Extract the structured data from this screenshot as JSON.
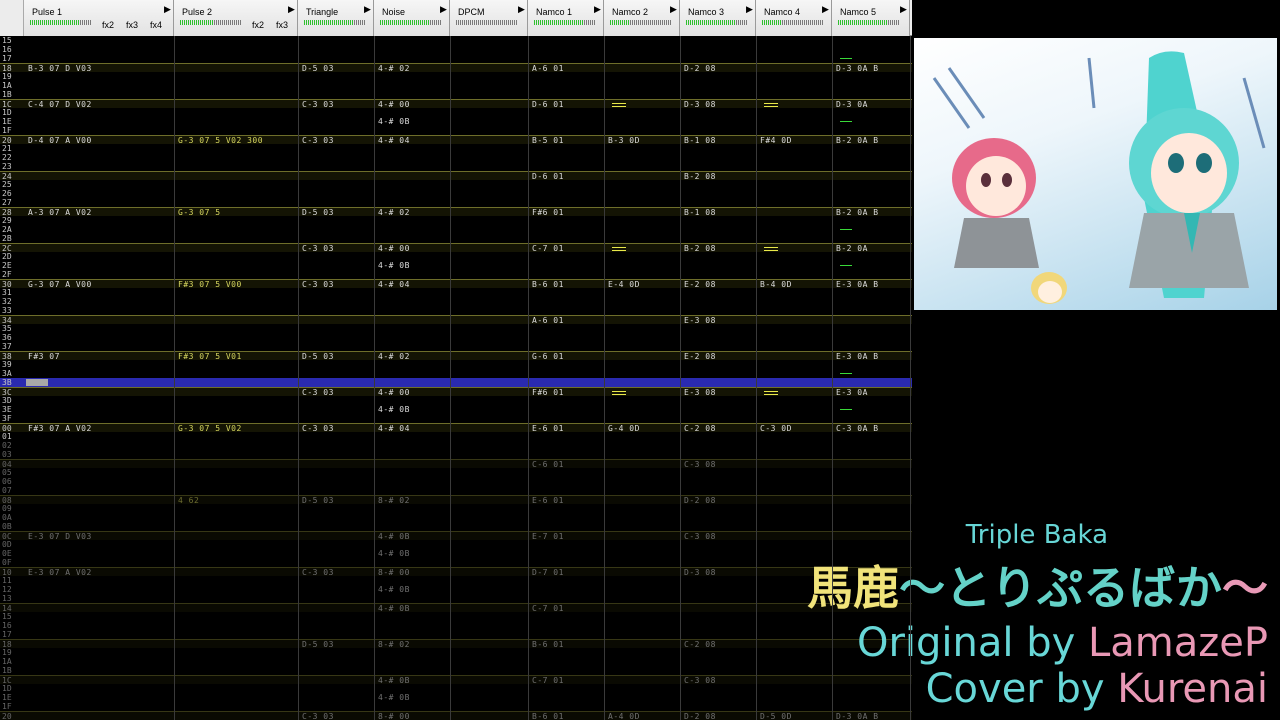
{
  "channels": [
    {
      "name": "Pulse 1",
      "fx": [
        "fx2",
        "fx3",
        "fx4"
      ],
      "meter": 0.8
    },
    {
      "name": "Pulse 2",
      "fx": [
        "fx2",
        "fx3"
      ],
      "meter": 0.55
    },
    {
      "name": "Triangle",
      "fx": [],
      "meter": 0.8
    },
    {
      "name": "Noise",
      "fx": [],
      "meter": 0.8
    },
    {
      "name": "DPCM",
      "fx": [],
      "meter": 0
    },
    {
      "name": "Namco 1",
      "fx": [],
      "meter": 0.8
    },
    {
      "name": "Namco 2",
      "fx": [],
      "meter": 0.3
    },
    {
      "name": "Namco 3",
      "fx": [],
      "meter": 0.8
    },
    {
      "name": "Namco 4",
      "fx": [],
      "meter": 0.3
    },
    {
      "name": "Namco 5",
      "fx": [],
      "meter": 0.8
    }
  ],
  "rows": [
    {
      "n": "15"
    },
    {
      "n": "16"
    },
    {
      "n": "17"
    },
    {
      "n": "18",
      "c": [
        "B-3 07 D V03",
        "",
        "D-5 03",
        "4-# 02",
        "",
        "A-6 01",
        "",
        "D-2 08",
        "",
        "D-3 0A B"
      ]
    },
    {
      "n": "19"
    },
    {
      "n": "1A"
    },
    {
      "n": "1B"
    },
    {
      "n": "1C",
      "c": [
        "C-4 07 D V02",
        "",
        "C-3 03",
        "4-# 00",
        "",
        "D-6 01",
        "",
        "D-3 08",
        "",
        "D-3 0A"
      ]
    },
    {
      "n": "1D"
    },
    {
      "n": "1E",
      "c": [
        "",
        "",
        "",
        "4-# 0B",
        "",
        "",
        "",
        "",
        "",
        ""
      ]
    },
    {
      "n": "1F"
    },
    {
      "n": "20",
      "c": [
        "D-4 07 A V00",
        "G-3 07 5 V02 300",
        "C-3 03",
        "4-# 04",
        "",
        "B-5 01",
        "B-3 0D",
        "B-1 08",
        "F#4 0D",
        "B-2 0A B"
      ]
    },
    {
      "n": "21"
    },
    {
      "n": "22"
    },
    {
      "n": "23"
    },
    {
      "n": "24",
      "c": [
        "",
        "",
        "",
        "",
        "",
        "D-6 01",
        "",
        "B-2 08",
        "",
        ""
      ]
    },
    {
      "n": "25"
    },
    {
      "n": "26"
    },
    {
      "n": "27"
    },
    {
      "n": "28",
      "c": [
        "A-3 07 A V02",
        "G-3 07 5",
        "D-5 03",
        "4-# 02",
        "",
        "F#6 01",
        "",
        "B-1 08",
        "",
        "B-2 0A B"
      ]
    },
    {
      "n": "29"
    },
    {
      "n": "2A"
    },
    {
      "n": "2B"
    },
    {
      "n": "2C",
      "c": [
        "",
        "",
        "C-3 03",
        "4-# 00",
        "",
        "C-7 01",
        "",
        "B-2 08",
        "",
        "B-2 0A"
      ]
    },
    {
      "n": "2D"
    },
    {
      "n": "2E",
      "c": [
        "",
        "",
        "",
        "4-# 0B",
        "",
        "",
        "",
        "",
        "",
        ""
      ]
    },
    {
      "n": "2F"
    },
    {
      "n": "30",
      "c": [
        "G-3 07 A V00",
        "F#3 07 5 V00",
        "C-3 03",
        "4-# 04",
        "",
        "B-6 01",
        "E-4 0D",
        "E-2 08",
        "B-4 0D",
        "E-3 0A B"
      ]
    },
    {
      "n": "31"
    },
    {
      "n": "32"
    },
    {
      "n": "33"
    },
    {
      "n": "34",
      "c": [
        "",
        "",
        "",
        "",
        "",
        "A-6 01",
        "",
        "E-3 08",
        "",
        ""
      ]
    },
    {
      "n": "35"
    },
    {
      "n": "36"
    },
    {
      "n": "37"
    },
    {
      "n": "38",
      "c": [
        "F#3 07",
        "F#3 07 5 V01",
        "D-5 03",
        "4-# 02",
        "",
        "G-6 01",
        "",
        "E-2 08",
        "",
        "E-3 0A B"
      ]
    },
    {
      "n": "39"
    },
    {
      "n": "3A"
    },
    {
      "n": "3B"
    },
    {
      "n": "3C",
      "c": [
        "",
        "",
        "C-3 03",
        "4-# 00",
        "",
        "F#6 01",
        "",
        "E-3 08",
        "",
        "E-3 0A"
      ]
    },
    {
      "n": "3D"
    },
    {
      "n": "3E",
      "c": [
        "",
        "",
        "",
        "4-# 0B",
        "",
        "",
        "",
        "",
        "",
        ""
      ]
    },
    {
      "n": "3F"
    },
    {
      "n": "00",
      "c": [
        "F#3 07 A V02",
        "G-3 07 5 V02",
        "C-3 03",
        "4-# 04",
        "",
        "E-6 01",
        "G-4 0D",
        "C-2 08",
        "C-3 0D",
        "C-3 0A B"
      ]
    },
    {
      "n": "01"
    },
    {
      "n": "02"
    },
    {
      "n": "03"
    },
    {
      "n": "04",
      "c": [
        "",
        "",
        "",
        "",
        "",
        "C-6 01",
        "",
        "C-3 08",
        "",
        ""
      ]
    },
    {
      "n": "05"
    },
    {
      "n": "06"
    },
    {
      "n": "07"
    },
    {
      "n": "08",
      "c": [
        "",
        "4 62",
        "D-5 03",
        "8-# 02",
        "",
        "E-6 01",
        "",
        "D-2 08",
        "",
        ""
      ]
    },
    {
      "n": "09"
    },
    {
      "n": "0A"
    },
    {
      "n": "0B"
    },
    {
      "n": "0C",
      "c": [
        "E-3 07 D V03",
        "",
        "",
        "4-# 0B",
        "",
        "E-7 01",
        "",
        "C-3 08",
        "",
        ""
      ]
    },
    {
      "n": "0D"
    },
    {
      "n": "0E",
      "c": [
        "",
        "",
        "",
        "4-# 0B",
        "",
        "",
        "",
        "",
        "",
        ""
      ]
    },
    {
      "n": "0F"
    },
    {
      "n": "10",
      "c": [
        "E-3 07 A V02",
        "",
        "C-3 03",
        "8-# 00",
        "",
        "D-7 01",
        "",
        "D-3 08",
        "",
        ""
      ]
    },
    {
      "n": "11"
    },
    {
      "n": "12",
      "c": [
        "",
        "",
        "",
        "4-# 0B",
        "",
        "",
        "",
        "",
        "",
        ""
      ]
    },
    {
      "n": "13"
    },
    {
      "n": "14",
      "c": [
        "",
        "",
        "",
        "4-# 0B",
        "",
        "C-7 01",
        "",
        "",
        "",
        ""
      ]
    },
    {
      "n": "15"
    },
    {
      "n": "16"
    },
    {
      "n": "17"
    },
    {
      "n": "18",
      "c": [
        "",
        "",
        "D-5 03",
        "8-# 02",
        "",
        "B-6 01",
        "",
        "C-2 08",
        "",
        ""
      ]
    },
    {
      "n": "19"
    },
    {
      "n": "1A"
    },
    {
      "n": "1B"
    },
    {
      "n": "1C",
      "c": [
        "",
        "",
        "",
        "4-# 0B",
        "",
        "C-7 01",
        "",
        "C-3 08",
        "",
        ""
      ]
    },
    {
      "n": "1D"
    },
    {
      "n": "1E",
      "c": [
        "",
        "",
        "",
        "4-# 0B",
        "",
        "",
        "",
        "",
        "",
        ""
      ]
    },
    {
      "n": "1F"
    },
    {
      "n": "20",
      "c": [
        "",
        "",
        "C-3 03",
        "8-# 00",
        "",
        "B-6 01",
        "A-4 0D",
        "D-2 08",
        "D-5 0D",
        "D-3 0A B"
      ]
    }
  ],
  "titles": {
    "english": "Triple Baka",
    "jp_kanji": "馬鹿",
    "jp_kana": "〜とりぷるばか",
    "jp_tail": "〜",
    "original_prefix": "Original by ",
    "original_name": "LamazeP",
    "cover_prefix": "Cover by ",
    "cover_name": "Kurenai"
  },
  "colors": {
    "cursor_row": "#2a2ab0",
    "note_text": "#dddddd",
    "eq_mark": "#e9e94a",
    "dash_mark": "#39d939",
    "title_cyan": "#68d7d7",
    "title_pink": "#e998b5",
    "title_yellow": "#f1e37a"
  }
}
